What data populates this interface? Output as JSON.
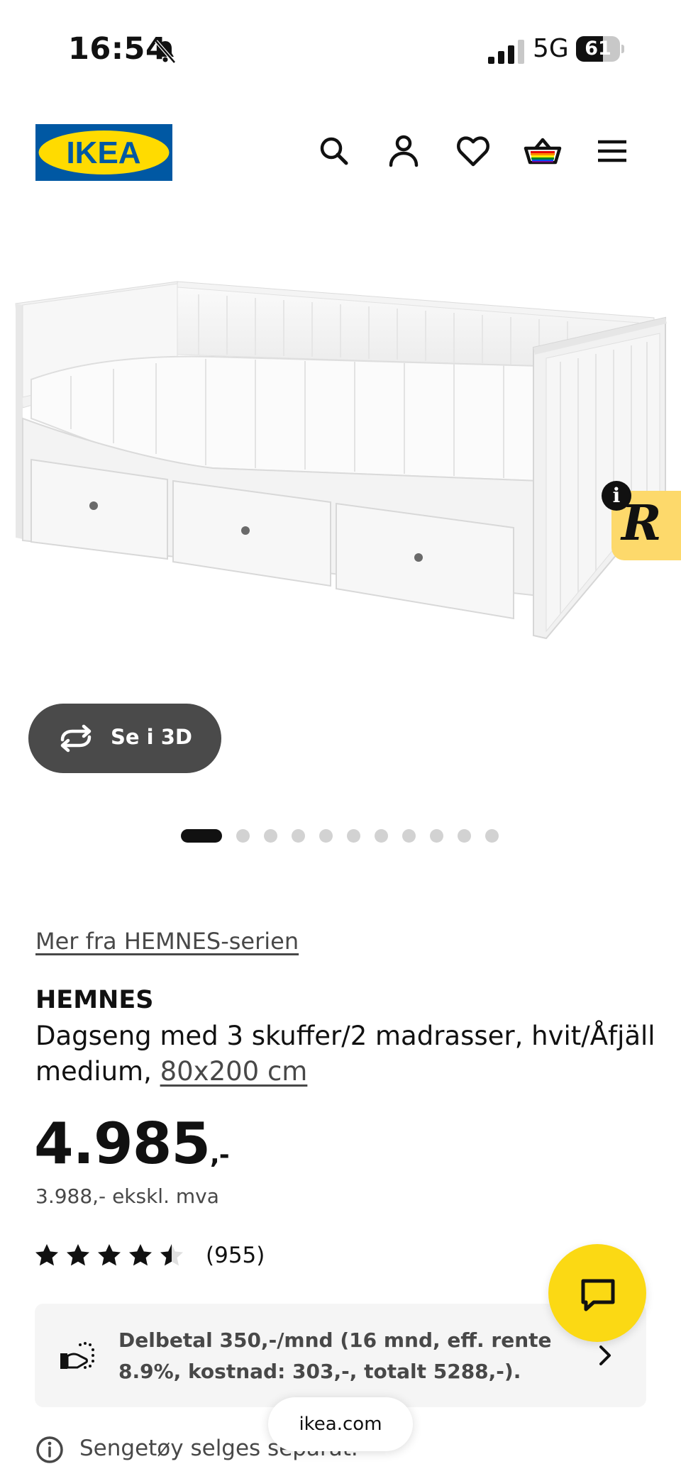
{
  "status_bar": {
    "time": "16:54",
    "network": "5G",
    "battery": "61",
    "battery_level": 0.61
  },
  "header": {
    "logo_text": "IKEA",
    "colors": {
      "logo_blue": "#0058a3",
      "logo_yellow": "#ffdb00"
    },
    "icons": [
      "search-icon",
      "account-icon",
      "heart-icon",
      "basket-icon",
      "menu-icon"
    ]
  },
  "gallery": {
    "view_3d_label": "Se i 3D",
    "dots_total": 11,
    "active_dot": 0,
    "badge_letter": "R",
    "info_glyph": "i"
  },
  "product": {
    "series_link": "Mer fra HEMNES-serien",
    "name": "HEMNES",
    "description": "Dagseng med 3 skuffer/2 madrasser, hvit/Åfjäll medium, ",
    "size_link": "80x200 cm",
    "price_main": "4.985",
    "price_suffix": ",-",
    "price_ex_vat": "3.988,- ekskl. mva",
    "rating": 4.5,
    "rating_max": 5,
    "rating_count": "(955)"
  },
  "financing": {
    "text": "Delbetal 350,-/mnd (16 mnd, eff. rente 8.9%, kostnad: 303,-, totalt 5288,-)."
  },
  "chat": {
    "accent": "#fbd914"
  },
  "notice": {
    "text": "Sengetøy selges separat."
  },
  "browser": {
    "url": "ikea.com"
  }
}
